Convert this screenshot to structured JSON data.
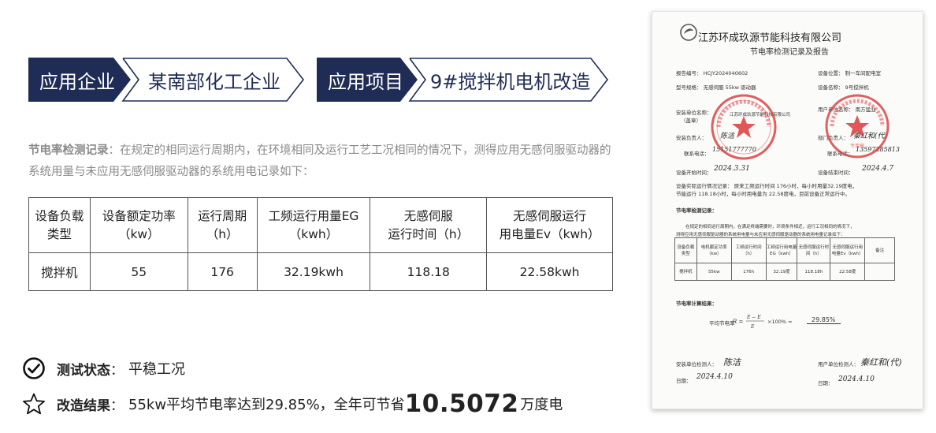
{
  "banner": {
    "company_tag": "应用企业",
    "company_name": "某南部化工企业",
    "project_tag": "应用项目",
    "project_name": "9#搅拌机电机改造"
  },
  "intro": {
    "lead": "节电率检测记录",
    "body": "：在规定的相同运行周期内，在环境相同及运行工艺工况相同的情况下，测得应用无感伺服驱动器的系统用量与未应用无感伺服驱动器的系统用电记录如下："
  },
  "table": {
    "headers": [
      [
        "设备负载",
        "类型"
      ],
      [
        "设备额定功率",
        "（kw）"
      ],
      [
        "运行周期",
        "（h）"
      ],
      [
        "工频运行用量EG",
        "（kwh）"
      ],
      [
        "无感伺服",
        "运行时间（h）"
      ],
      [
        "无感伺服运行",
        "用电量Ev（kwh）"
      ]
    ],
    "row": [
      "搅拌机",
      "55",
      "176",
      "32.19kwh",
      "118.18",
      "22.58kwh"
    ]
  },
  "status": {
    "label": "测试状态",
    "value": "平稳工况"
  },
  "result": {
    "label": "改造结果",
    "value_prefix": "55kw平均节电率达到29.85%，全年可节省",
    "value_big": "10.5072",
    "value_suffix": "万度电"
  },
  "report": {
    "company": "江苏环成玖源节能科技有限公司",
    "title": "节电率检测记录及报告",
    "report_no": "报告编号：   HCJY2024040602",
    "location": "设备位置：   制一车间配电室",
    "model": "型号规格：   无感伺服 55kw 驱动器",
    "device_name": "设备名称：   9号搅拌机",
    "install_unit": "安装单位名称：",
    "install_unit_stamp": "（盖章）",
    "install_unit_value": "江苏环成玖源节能科技有限公司",
    "user_unit": "用户单位名称：   南方猛业",
    "install_person": "安装负责人：",
    "install_person_sign": "陈洁",
    "dept_person": "部门负责人：",
    "dept_person_sign": "秦红和(代)",
    "phone_label": "联系电话：",
    "phone_left": "15151777770",
    "phone_right": "13597285813",
    "start_time": "设备开始时间：",
    "start_time_value": "2024.3.31",
    "end_time": "设备结束时间：",
    "end_time_value": "2024.4.7",
    "run_desc_1": "设备实际运行情况记录：   原来工频运行时间 176小时，每小时用量32.19度电，",
    "run_desc_2": "节能运行 118.18小时，每小时用电量为 22.58度电，目前设备正常运行中。",
    "section_record": "节电率检测记录：",
    "record_text_1": "在规定的相同运行周期内，在满足终端需要时，环境条件相近，运行工况相同的情况下，",
    "record_text_2": "测得应用无感伺服驱动器的系统用电量与未应用无感伺服驱动器的系统用电量记录如下：",
    "mini_headers": [
      "设备负载类型",
      "电机额定功率（kw）",
      "工频运行时间（h）",
      "工频运行用电量EG（kwh）",
      "无感伺服运行时间（h）",
      "无感伺服运行用电量Ev（kwh）",
      "备注"
    ],
    "mini_row": [
      "搅拌机",
      "55kw",
      "176h",
      "32.19度",
      "118.18h",
      "22.58度",
      ""
    ],
    "section_calc": "节电率计算结果：",
    "formula_label": "平均节电率",
    "formula_result": "29.85%",
    "sign_install": "安装单位检测人：",
    "sign_install_value": "陈洁",
    "sign_user": "用户单位检测人：",
    "sign_user_value": "秦红和(代)",
    "date_label": "日期：",
    "date_left": "2024.4.10",
    "date_right": "2024.4.10",
    "stamp_left_text": "江苏环成玖源节能科技有限公司",
    "stamp_right_text": "南方猛业有限公司"
  },
  "colors": {
    "navy": "#1f2d56",
    "stamp_red": "#d93a3a",
    "muted_text": "#8a8a8a"
  }
}
